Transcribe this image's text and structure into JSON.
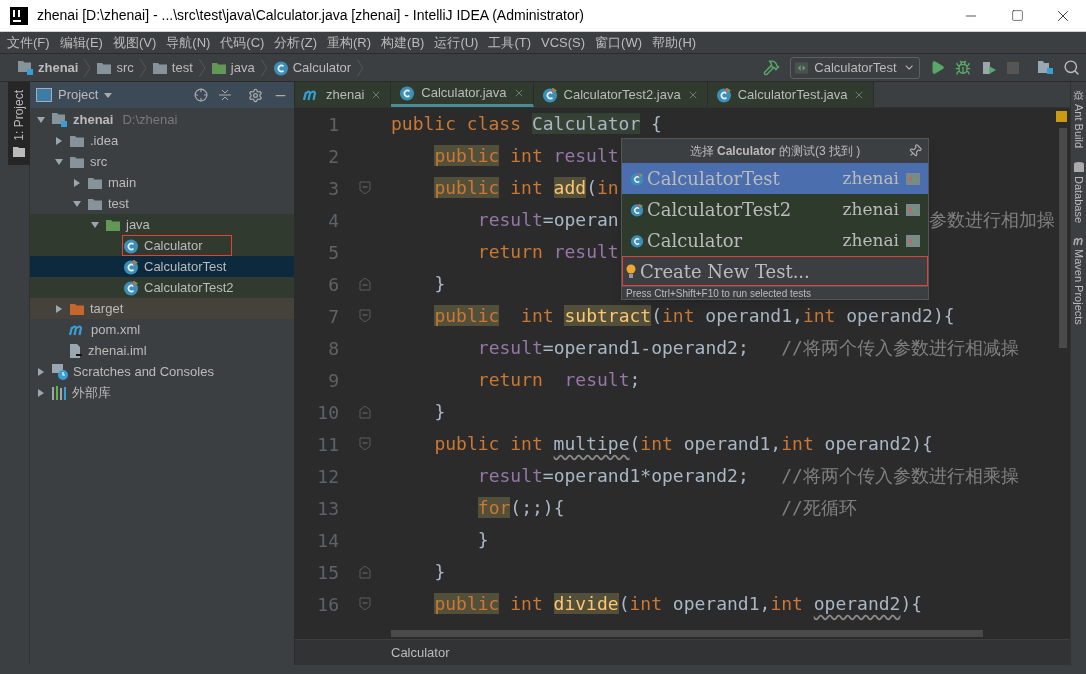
{
  "window": {
    "title": "zhenai [D:\\zhenai] - ...\\src\\test\\java\\Calculator.java [zhenai] - IntelliJ IDEA (Administrator)"
  },
  "menu": [
    "文件(F)",
    "编辑(E)",
    "视图(V)",
    "导航(N)",
    "代码(C)",
    "分析(Z)",
    "重构(R)",
    "构建(B)",
    "运行(U)",
    "工具(T)",
    "VCS(S)",
    "窗口(W)",
    "帮助(H)"
  ],
  "breadcrumbs": [
    {
      "label": "zhenai",
      "kind": "module"
    },
    {
      "label": "src",
      "kind": "folder"
    },
    {
      "label": "test",
      "kind": "folder"
    },
    {
      "label": "java",
      "kind": "test-root"
    },
    {
      "label": "Calculator",
      "kind": "class"
    }
  ],
  "run_config": {
    "label": "CalculatorTest"
  },
  "left_stripe": {
    "label": "1: Project",
    "selected": true
  },
  "project_panel": {
    "title": "Project",
    "tree": [
      {
        "label": "zhenai",
        "path": "D:\\zhenai",
        "kind": "module",
        "expanded": true,
        "selected": false,
        "children": [
          {
            "label": ".idea",
            "kind": "folder",
            "expanded": false,
            "selected": false
          },
          {
            "label": "src",
            "kind": "folder",
            "expanded": true,
            "selected": false,
            "children": [
              {
                "label": "main",
                "kind": "folder",
                "expanded": false,
                "selected": false
              },
              {
                "label": "test",
                "kind": "folder",
                "expanded": true,
                "selected": false,
                "children": [
                  {
                    "label": "java",
                    "kind": "test-root",
                    "expanded": true,
                    "selected": false,
                    "children": [
                      {
                        "label": "Calculator",
                        "kind": "class",
                        "selected": false,
                        "outlined": true
                      },
                      {
                        "label": "CalculatorTest",
                        "kind": "test",
                        "selected": true,
                        "outlined": false
                      },
                      {
                        "label": "CalculatorTest2",
                        "kind": "test",
                        "selected": false,
                        "outlined": false
                      }
                    ]
                  }
                ]
              }
            ]
          },
          {
            "label": "target",
            "kind": "excluded",
            "expanded": false,
            "selected": false
          },
          {
            "label": "pom.xml",
            "kind": "maven",
            "selected": false
          },
          {
            "label": "zhenai.iml",
            "kind": "iml",
            "selected": false
          }
        ]
      },
      {
        "label": "Scratches and Consoles",
        "kind": "scratches",
        "expanded": false,
        "selected": false
      },
      {
        "label": "外部库",
        "kind": "libraries",
        "expanded": false,
        "selected": false
      }
    ]
  },
  "editor_tabs": [
    {
      "label": "zhenai",
      "kind": "maven",
      "selected": false
    },
    {
      "label": "Calculator.java",
      "kind": "class",
      "selected": true
    },
    {
      "label": "CalculatorTest2.java",
      "kind": "test",
      "selected": false
    },
    {
      "label": "CalculatorTest.java",
      "kind": "test",
      "selected": false
    }
  ],
  "code": [
    {
      "number": "1",
      "tokens": [
        {
          "kind": "kw",
          "t": "public class "
        },
        {
          "kind": "class-mark",
          "t": "Calculator"
        },
        {
          "kind": "text",
          "t": " {"
        }
      ],
      "children": [
        {
          "number": "2",
          "tokens": [
            {
              "kind": "kw-mark",
              "t": "public"
            },
            {
              "kind": "kw",
              "t": " int "
            },
            {
              "kind": "field",
              "t": "result"
            }
          ]
        },
        {
          "number": "3",
          "kind": "fold-start",
          "tokens": [
            {
              "kind": "kw-mark",
              "t": "public"
            },
            {
              "kind": "kw",
              "t": " int "
            },
            {
              "kind": "method-mark",
              "t": "add"
            },
            {
              "kind": "text",
              "t": "("
            },
            {
              "kind": "kw",
              "t": "in"
            }
          ],
          "children": [
            {
              "number": "4",
              "tokens": [
                {
                  "kind": "field",
                  "t": "result"
                },
                {
                  "kind": "text",
                  "t": "=operan"
                }
              ],
              "tail": [
                {
                  "kind": "comment",
                  "t": "参数进行相加操"
                }
              ]
            },
            {
              "number": "5",
              "tokens": [
                {
                  "kind": "kw",
                  "t": "return "
                },
                {
                  "kind": "field",
                  "t": "result"
                }
              ]
            }
          ]
        },
        {
          "number": "6",
          "kind": "fold-end",
          "tokens": [
            {
              "kind": "text",
              "t": "}"
            }
          ]
        },
        {
          "number": "7",
          "kind": "fold-start",
          "tokens": [
            {
              "kind": "kw-mark",
              "t": "public"
            },
            {
              "kind": "kw",
              "t": "  int "
            },
            {
              "kind": "method-mark",
              "t": "subtract"
            },
            {
              "kind": "text",
              "t": "("
            },
            {
              "kind": "kw",
              "t": "int"
            },
            {
              "kind": "text",
              "t": " operand1,"
            },
            {
              "kind": "kw",
              "t": "int"
            },
            {
              "kind": "text",
              "t": " operand2){"
            }
          ],
          "children": [
            {
              "number": "8",
              "tokens": [
                {
                  "kind": "field",
                  "t": "result"
                },
                {
                  "kind": "text",
                  "t": "=operand1-operand2;   "
                },
                {
                  "kind": "comment",
                  "t": "//将两个传入参数进行相减操"
                }
              ]
            },
            {
              "number": "9",
              "tokens": [
                {
                  "kind": "kw",
                  "t": "return  "
                },
                {
                  "kind": "field",
                  "t": "result"
                },
                {
                  "kind": "text",
                  "t": ";"
                }
              ]
            }
          ]
        },
        {
          "number": "10",
          "kind": "fold-end",
          "tokens": [
            {
              "kind": "text",
              "t": "}"
            }
          ]
        },
        {
          "number": "11",
          "kind": "fold-start",
          "tokens": [
            {
              "kind": "kw",
              "t": "public int "
            },
            {
              "kind": "text-warn",
              "t": "multipe"
            },
            {
              "kind": "text",
              "t": "("
            },
            {
              "kind": "kw",
              "t": "int"
            },
            {
              "kind": "text",
              "t": " operand1,"
            },
            {
              "kind": "kw",
              "t": "int"
            },
            {
              "kind": "text",
              "t": " operand2){"
            }
          ],
          "children": [
            {
              "number": "12",
              "tokens": [
                {
                  "kind": "field",
                  "t": "result"
                },
                {
                  "kind": "text",
                  "t": "=operand1*operand2;   "
                },
                {
                  "kind": "comment",
                  "t": "//将两个传入参数进行相乘操"
                }
              ]
            },
            {
              "number": "13",
              "tokens": [
                {
                  "kind": "kw-mark",
                  "t": "for"
                },
                {
                  "kind": "text",
                  "t": "(;;){                    "
                },
                {
                  "kind": "comment",
                  "t": "//死循环"
                }
              ]
            },
            {
              "number": "14",
              "tokens": [
                {
                  "kind": "text",
                  "t": "}"
                }
              ]
            }
          ]
        },
        {
          "number": "15",
          "kind": "fold-end",
          "tokens": [
            {
              "kind": "text",
              "t": "}"
            }
          ]
        },
        {
          "number": "16",
          "kind": "fold-start",
          "tokens": [
            {
              "kind": "kw-mark",
              "t": "public"
            },
            {
              "kind": "kw",
              "t": " int "
            },
            {
              "kind": "method-mark",
              "t": "divide"
            },
            {
              "kind": "text",
              "t": "("
            },
            {
              "kind": "kw",
              "t": "int"
            },
            {
              "kind": "text",
              "t": " operand1,"
            },
            {
              "kind": "kw",
              "t": "int "
            },
            {
              "kind": "text-warn",
              "t": "operand2"
            },
            {
              "kind": "text",
              "t": "){"
            }
          ]
        }
      ]
    }
  ],
  "test_popup": {
    "title": "选择 **Calculator** 的测试(3 找到 )",
    "items": [
      {
        "name": "CalculatorTest",
        "module": "zhenai",
        "kind": "test",
        "selected": true
      },
      {
        "name": "CalculatorTest2",
        "module": "zhenai",
        "kind": "test",
        "selected": false
      },
      {
        "name": "Calculator",
        "module": "zhenai",
        "kind": "class",
        "selected": false
      }
    ],
    "action": {
      "label": "Create New Test...",
      "outlined": true
    },
    "hint": "Press Ctrl+Shift+F10 to run selected tests"
  },
  "right_stripe": [
    {
      "label": "Ant Build",
      "kind": "ant"
    },
    {
      "label": "Database",
      "kind": "database"
    },
    {
      "label": "Maven Projects",
      "kind": "maven"
    }
  ],
  "status_bar": {
    "breadcrumb": "Calculator"
  }
}
